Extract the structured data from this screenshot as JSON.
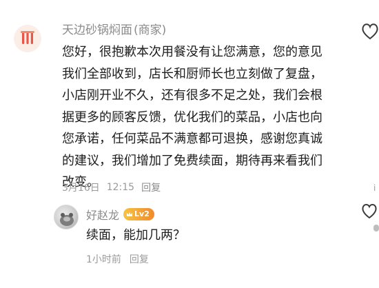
{
  "merchant": {
    "name": "天边砂锅焖面",
    "tag": "(商家)",
    "reply_lines": [
      "您好，很抱歉本次用餐没有让您满意，您的意见",
      "我们全部收到，店长和厨师长也立刻做了复盘，",
      "小店刚开业不久，还有很多不足之处，我们会根",
      "据更多的顾客反馈，优化我们的菜品，小店也向",
      "您承诺，任何菜品不满意都可退换，感谢您真诚",
      "的建议，我们增加了免费续面，期待再来看我们",
      "改变。"
    ],
    "date": "3月16日",
    "time": "12:15",
    "reply_label": "回复",
    "avatar_icon": "merchant-shop-logo-icon"
  },
  "reply": {
    "user_name": "好赵龙",
    "level_badge": "Lv2",
    "text": "续面，能加几两？",
    "time": "1小时前",
    "reply_label": "回复",
    "avatar_icon": "user-avatar-icon"
  },
  "edge": {
    "partial_char": "i"
  },
  "colors": {
    "meta_gray": "#9a9a9a",
    "text": "#1c1c1c",
    "badge_start": "#f6c343",
    "badge_end": "#f08a2c",
    "logo_red": "#e8584a"
  }
}
